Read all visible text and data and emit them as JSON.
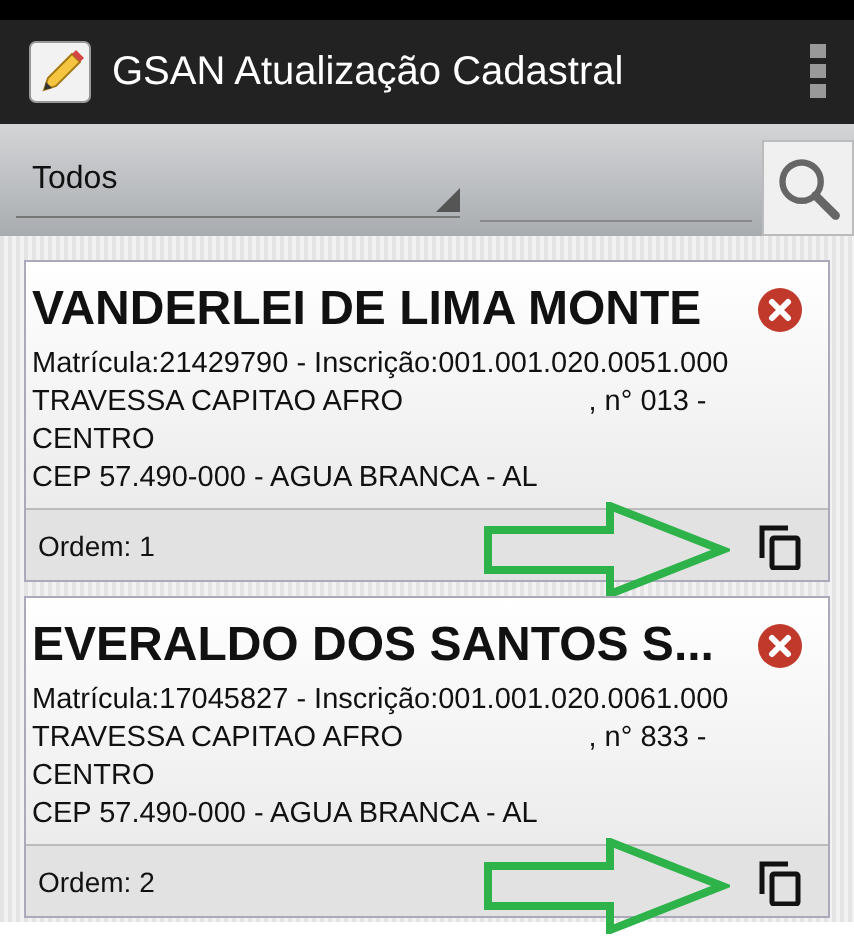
{
  "app_bar": {
    "title": "GSAN Atualização Cadastral"
  },
  "filter": {
    "value": "Todos"
  },
  "cards": [
    {
      "name": "VANDERLEI DE LIMA MONTE",
      "ids": "Matrícula:21429790  -  Inscrição:001.001.020.0051.000",
      "address": "TRAVESSA CAPITAO AFRO                       , n° 013 - CENTRO",
      "city": "CEP 57.490-000 - AGUA BRANCA - AL",
      "order": "Ordem: 1",
      "arrow": true
    },
    {
      "name": "EVERALDO DOS SANTOS S...",
      "ids": "Matrícula:17045827  -  Inscrição:001.001.020.0061.000",
      "address": "TRAVESSA CAPITAO AFRO                       , n° 833 - CENTRO",
      "city": "CEP 57.490-000 - AGUA BRANCA - AL",
      "order": "Ordem: 2",
      "arrow": true
    }
  ]
}
